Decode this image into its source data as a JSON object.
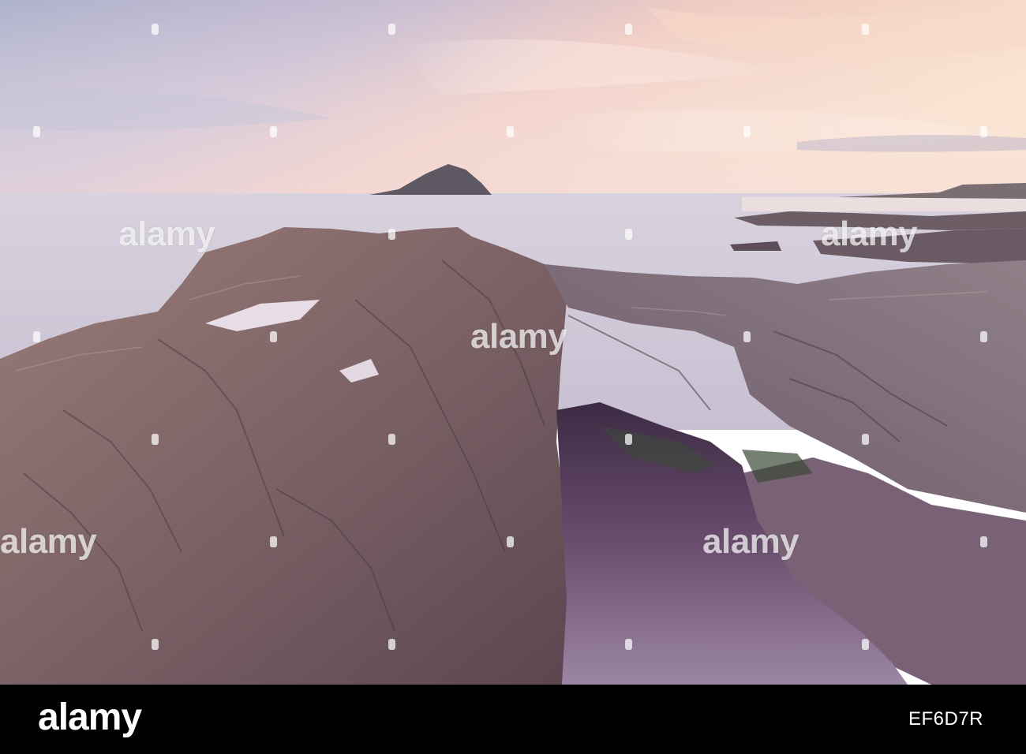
{
  "watermark": {
    "brand": "alamy"
  },
  "footer": {
    "logo": "alamy",
    "image_id": "EF6D7R"
  },
  "colors": {
    "footer_bg": "#000000",
    "sky_peach": "#f6d6c6",
    "sky_lilac": "#bfb7cf",
    "rock": "#7a6163",
    "pool": "#4a3350"
  }
}
